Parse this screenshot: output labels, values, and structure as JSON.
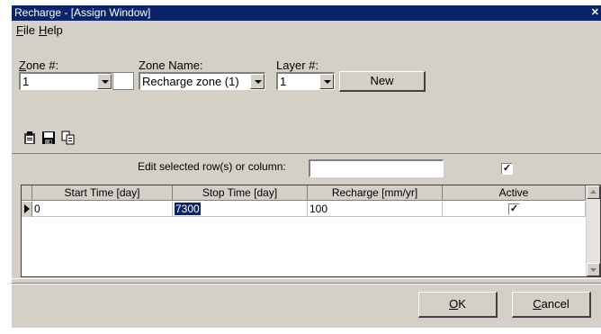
{
  "window": {
    "title": "Recharge - [Assign Window]",
    "close_glyph": "✕"
  },
  "menu": {
    "items": [
      {
        "label": "File",
        "mnemonic": "F",
        "rest": "ile"
      },
      {
        "label": "Help",
        "mnemonic": "H",
        "rest": "elp"
      }
    ]
  },
  "zone": {
    "number_label_mn": "Z",
    "number_label_rest": "one #:",
    "number_value": "1",
    "name_label": "Zone Name:",
    "name_value": "Recharge zone (1)",
    "layer_label": "Layer #:",
    "layer_value": "1",
    "new_button": "New"
  },
  "toolbar": {
    "icons": [
      "paste-icon",
      "save-icon",
      "copy-icon"
    ]
  },
  "edit": {
    "label": "Edit selected row(s) or column:",
    "value": "",
    "checked": true
  },
  "table": {
    "columns": [
      "Start Time [day]",
      "Stop Time [day]",
      "Recharge [mm/yr]",
      "Active"
    ],
    "rows": [
      {
        "start": "0",
        "stop": "7300",
        "recharge": "100",
        "active": true
      }
    ]
  },
  "buttons": {
    "ok_mn": "O",
    "ok_rest": "K",
    "cancel_mn": "C",
    "cancel_rest": "ancel"
  },
  "check_glyph": "✓"
}
